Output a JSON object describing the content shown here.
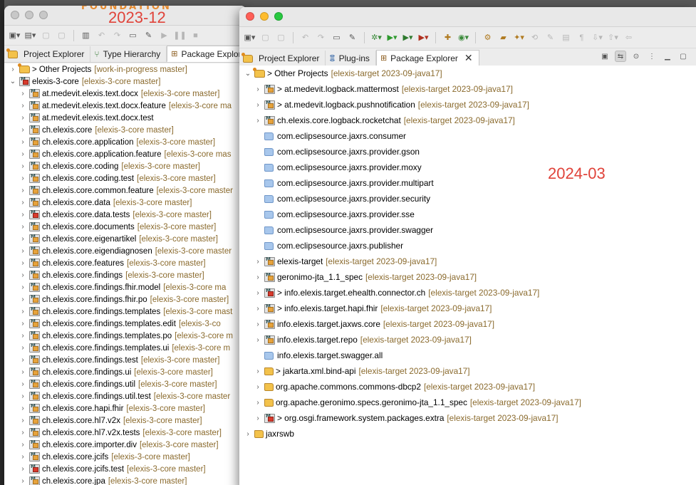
{
  "annotations": {
    "back_label": "2023-12",
    "front_label": "2024-03",
    "foundation": "FOUNDATION"
  },
  "back_window": {
    "tabs": [
      "Project Explorer",
      "Type Hierarchy",
      "Package Explore"
    ],
    "tree": [
      {
        "twisty": ">",
        "icon": "working",
        "name": "> Other Projects",
        "repo": "[work-in-progress master]",
        "indent": 0
      },
      {
        "twisty": "v",
        "icon": "plugin-err",
        "name": "elexis-3-core",
        "repo": "[elexis-3-core master]",
        "indent": 0
      },
      {
        "twisty": ">",
        "icon": "plugin",
        "name": "at.medevit.elexis.text.docx",
        "repo": "[elexis-3-core master]",
        "indent": 1
      },
      {
        "twisty": ">",
        "icon": "plugin",
        "name": "at.medevit.elexis.text.docx.feature",
        "repo": "[elexis-3-core ma",
        "indent": 1
      },
      {
        "twisty": ">",
        "icon": "plugin",
        "name": "at.medevit.elexis.text.docx.test",
        "repo": "",
        "indent": 1
      },
      {
        "twisty": ">",
        "icon": "plugin",
        "name": "ch.elexis.core",
        "repo": "[elexis-3-core master]",
        "indent": 1
      },
      {
        "twisty": ">",
        "icon": "plugin",
        "name": "ch.elexis.core.application",
        "repo": "[elexis-3-core master]",
        "indent": 1
      },
      {
        "twisty": ">",
        "icon": "plugin",
        "name": "ch.elexis.core.application.feature",
        "repo": "[elexis-3-core mas",
        "indent": 1
      },
      {
        "twisty": ">",
        "icon": "plugin",
        "name": "ch.elexis.core.coding",
        "repo": "[elexis-3-core master]",
        "indent": 1
      },
      {
        "twisty": ">",
        "icon": "plugin",
        "name": "ch.elexis.core.coding.test",
        "repo": "[elexis-3-core master]",
        "indent": 1
      },
      {
        "twisty": ">",
        "icon": "plugin",
        "name": "ch.elexis.core.common.feature",
        "repo": "[elexis-3-core master",
        "indent": 1
      },
      {
        "twisty": ">",
        "icon": "plugin",
        "name": "ch.elexis.core.data",
        "repo": "[elexis-3-core master]",
        "indent": 1
      },
      {
        "twisty": ">",
        "icon": "plugin-err",
        "name": "ch.elexis.core.data.tests",
        "repo": "[elexis-3-core master]",
        "indent": 1
      },
      {
        "twisty": ">",
        "icon": "plugin",
        "name": "ch.elexis.core.documents",
        "repo": "[elexis-3-core master]",
        "indent": 1
      },
      {
        "twisty": ">",
        "icon": "plugin",
        "name": "ch.elexis.core.eigenartikel",
        "repo": "[elexis-3-core master]",
        "indent": 1
      },
      {
        "twisty": ">",
        "icon": "plugin",
        "name": "ch.elexis.core.eigendiagnosen",
        "repo": "[elexis-3-core master",
        "indent": 1
      },
      {
        "twisty": ">",
        "icon": "plugin",
        "name": "ch.elexis.core.features",
        "repo": "[elexis-3-core master]",
        "indent": 1
      },
      {
        "twisty": ">",
        "icon": "plugin",
        "name": "ch.elexis.core.findings",
        "repo": "[elexis-3-core master]",
        "indent": 1
      },
      {
        "twisty": ">",
        "icon": "plugin",
        "name": "ch.elexis.core.findings.fhir.model",
        "repo": "[elexis-3-core ma",
        "indent": 1
      },
      {
        "twisty": ">",
        "icon": "plugin",
        "name": "ch.elexis.core.findings.fhir.po",
        "repo": "[elexis-3-core master]",
        "indent": 1
      },
      {
        "twisty": ">",
        "icon": "plugin",
        "name": "ch.elexis.core.findings.templates",
        "repo": "[elexis-3-core mast",
        "indent": 1
      },
      {
        "twisty": ">",
        "icon": "plugin",
        "name": "ch.elexis.core.findings.templates.edit",
        "repo": "[elexis-3-co",
        "indent": 1
      },
      {
        "twisty": ">",
        "icon": "plugin",
        "name": "ch.elexis.core.findings.templates.po",
        "repo": "[elexis-3-core m",
        "indent": 1
      },
      {
        "twisty": ">",
        "icon": "plugin",
        "name": "ch.elexis.core.findings.templates.ui",
        "repo": "[elexis-3-core m",
        "indent": 1
      },
      {
        "twisty": ">",
        "icon": "plugin",
        "name": "ch.elexis.core.findings.test",
        "repo": "[elexis-3-core master]",
        "indent": 1
      },
      {
        "twisty": ">",
        "icon": "plugin",
        "name": "ch.elexis.core.findings.ui",
        "repo": "[elexis-3-core master]",
        "indent": 1
      },
      {
        "twisty": ">",
        "icon": "plugin",
        "name": "ch.elexis.core.findings.util",
        "repo": "[elexis-3-core master]",
        "indent": 1
      },
      {
        "twisty": ">",
        "icon": "plugin",
        "name": "ch.elexis.core.findings.util.test",
        "repo": "[elexis-3-core master",
        "indent": 1
      },
      {
        "twisty": ">",
        "icon": "plugin",
        "name": "ch.elexis.core.hapi.fhir",
        "repo": "[elexis-3-core master]",
        "indent": 1
      },
      {
        "twisty": ">",
        "icon": "plugin",
        "name": "ch.elexis.core.hl7.v2x",
        "repo": "[elexis-3-core master]",
        "indent": 1
      },
      {
        "twisty": ">",
        "icon": "plugin",
        "name": "ch.elexis.core.hl7.v2x.tests",
        "repo": "[elexis-3-core master]",
        "indent": 1
      },
      {
        "twisty": ">",
        "icon": "plugin",
        "name": "ch.elexis.core.importer.div",
        "repo": "[elexis-3-core master]",
        "indent": 1
      },
      {
        "twisty": ">",
        "icon": "plugin",
        "name": "ch.elexis.core.jcifs",
        "repo": "[elexis-3-core master]",
        "indent": 1
      },
      {
        "twisty": ">",
        "icon": "plugin-err",
        "name": "ch.elexis.core.jcifs.test",
        "repo": "[elexis-3-core master]",
        "indent": 1
      },
      {
        "twisty": ">",
        "icon": "plugin",
        "name": "ch.elexis.core.jpa",
        "repo": "[elexis-3-core master]",
        "indent": 1
      }
    ]
  },
  "front_window": {
    "tabs": [
      "Project Explorer",
      "Plug-ins",
      "Package Explorer"
    ],
    "tree": [
      {
        "twisty": "v",
        "icon": "working",
        "name": "> Other Projects",
        "repo": "[elexis-target 2023-09-java17]",
        "indent": 0
      },
      {
        "twisty": ">",
        "icon": "plugin",
        "name": "> at.medevit.logback.mattermost",
        "repo": "[elexis-target 2023-09-java17]",
        "indent": 1
      },
      {
        "twisty": ">",
        "icon": "plugin",
        "name": "> at.medevit.logback.pushnotification",
        "repo": "[elexis-target 2023-09-java17]",
        "indent": 1
      },
      {
        "twisty": ">",
        "icon": "plugin",
        "name": "ch.elexis.core.logback.rocketchat",
        "repo": "[elexis-target 2023-09-java17]",
        "indent": 1
      },
      {
        "twisty": "",
        "icon": "folder",
        "name": "com.eclipsesource.jaxrs.consumer",
        "repo": "",
        "indent": 1
      },
      {
        "twisty": "",
        "icon": "folder",
        "name": "com.eclipsesource.jaxrs.provider.gson",
        "repo": "",
        "indent": 1
      },
      {
        "twisty": "",
        "icon": "folder",
        "name": "com.eclipsesource.jaxrs.provider.moxy",
        "repo": "",
        "indent": 1
      },
      {
        "twisty": "",
        "icon": "folder",
        "name": "com.eclipsesource.jaxrs.provider.multipart",
        "repo": "",
        "indent": 1
      },
      {
        "twisty": "",
        "icon": "folder",
        "name": "com.eclipsesource.jaxrs.provider.security",
        "repo": "",
        "indent": 1
      },
      {
        "twisty": "",
        "icon": "folder",
        "name": "com.eclipsesource.jaxrs.provider.sse",
        "repo": "",
        "indent": 1
      },
      {
        "twisty": "",
        "icon": "folder",
        "name": "com.eclipsesource.jaxrs.provider.swagger",
        "repo": "",
        "indent": 1
      },
      {
        "twisty": "",
        "icon": "folder",
        "name": "com.eclipsesource.jaxrs.publisher",
        "repo": "",
        "indent": 1
      },
      {
        "twisty": ">",
        "icon": "plugin",
        "name": "elexis-target",
        "repo": "[elexis-target 2023-09-java17]",
        "indent": 1
      },
      {
        "twisty": ">",
        "icon": "plugin",
        "name": "geronimo-jta_1.1_spec",
        "repo": "[elexis-target 2023-09-java17]",
        "indent": 1
      },
      {
        "twisty": ">",
        "icon": "plugin-err",
        "name": "> info.elexis.target.ehealth.connector.ch",
        "repo": "[elexis-target 2023-09-java17]",
        "indent": 1
      },
      {
        "twisty": ">",
        "icon": "plugin",
        "name": "> info.elexis.target.hapi.fhir",
        "repo": "[elexis-target 2023-09-java17]",
        "indent": 1
      },
      {
        "twisty": ">",
        "icon": "plugin",
        "name": "info.elexis.target.jaxws.core",
        "repo": "[elexis-target 2023-09-java17]",
        "indent": 1
      },
      {
        "twisty": ">",
        "icon": "plugin",
        "name": "info.elexis.target.repo",
        "repo": "[elexis-target 2023-09-java17]",
        "indent": 1
      },
      {
        "twisty": "",
        "icon": "folder",
        "name": "info.elexis.target.swagger.all",
        "repo": "",
        "indent": 1
      },
      {
        "twisty": ">",
        "icon": "jar",
        "name": "> jakarta.xml.bind-api",
        "repo": "[elexis-target 2023-09-java17]",
        "indent": 1
      },
      {
        "twisty": ">",
        "icon": "jar",
        "name": "org.apache.commons.commons-dbcp2",
        "repo": "[elexis-target 2023-09-java17]",
        "indent": 1
      },
      {
        "twisty": ">",
        "icon": "jar",
        "name": "org.apache.geronimo.specs.geronimo-jta_1.1_spec",
        "repo": "[elexis-target 2023-09-java17]",
        "indent": 1
      },
      {
        "twisty": ">",
        "icon": "plugin-err",
        "name": "> org.osgi.framework.system.packages.extra",
        "repo": "[elexis-target 2023-09-java17]",
        "indent": 1
      },
      {
        "twisty": ">",
        "icon": "jar",
        "name": "jaxrswb",
        "repo": "",
        "indent": 0
      }
    ]
  }
}
